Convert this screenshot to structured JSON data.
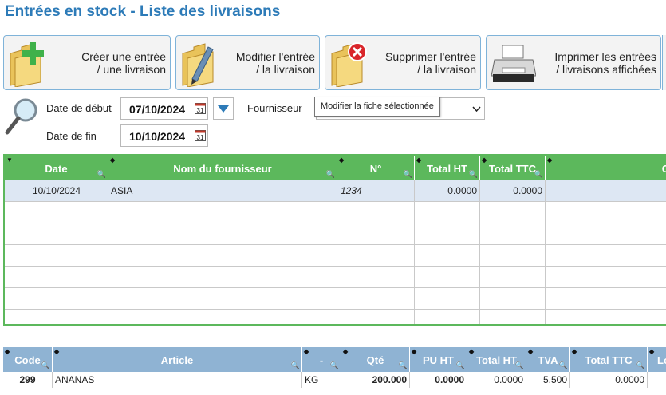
{
  "page": {
    "title": "Entrées en stock - Liste des livraisons"
  },
  "toolbar": {
    "create": {
      "line1": "Créer une entrée",
      "line2": "/ une livraison",
      "icon": "folder-add-icon"
    },
    "modify": {
      "line1": "Modifier l'entrée",
      "line2": "/ la livraison",
      "icon": "folder-edit-icon"
    },
    "delete": {
      "line1": "Supprimer l'entrée",
      "line2": "/ la livraison",
      "icon": "folder-delete-icon"
    },
    "print": {
      "line1": "Imprimer les entrées",
      "line2": "/ livraisons affichées",
      "icon": "printer-icon"
    }
  },
  "filters": {
    "start_label": "Date de début",
    "start_value": "07/10/2024",
    "end_label": "Date de fin",
    "end_value": "10/10/2024",
    "supplier_label": "Fournisseur",
    "calendar_day": "31",
    "tooltip": "Modifier la fiche sélectionnée"
  },
  "deliveries": {
    "columns": [
      "Date",
      "Nom du fournisseur",
      "N°",
      "Total HT",
      "Total TTC",
      "C"
    ],
    "rows": [
      {
        "date": "10/10/2024",
        "supplier": "ASIA",
        "number": "1234",
        "total_ht": "0.0000",
        "total_ttc": "0.0000"
      }
    ],
    "accent": "#5cb85c",
    "selected_row_color": "#dde7f3"
  },
  "articles": {
    "columns": [
      "Code",
      "Article",
      "-",
      "Qté",
      "PU HT",
      "Total HT",
      "TVA",
      "Total TTC",
      "Lo"
    ],
    "rows": [
      {
        "code": "299",
        "article": "ANANAS",
        "unit": "KG",
        "qty": "200.000",
        "pu_ht": "0.0000",
        "total_ht": "0.0000",
        "tva": "5.500",
        "total_ttc": "0.0000"
      }
    ],
    "header_color": "#8fb3d3"
  }
}
